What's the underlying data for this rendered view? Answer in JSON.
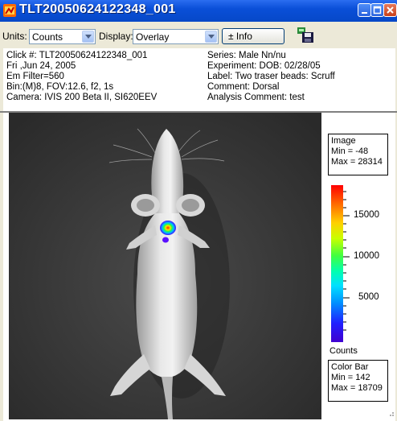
{
  "window": {
    "title": "TLT20050624122348_001"
  },
  "toolbar": {
    "units_label": "Units:",
    "units_value": "Counts",
    "display_label": "Display:",
    "display_value": "Overlay",
    "info_button": "± Info"
  },
  "info": {
    "left": [
      "Click #: TLT20050624122348_001",
      "Fri ,Jun 24, 2005",
      "Em Filter=560",
      "Bin:(M)8, FOV:12.6, f2, 1s",
      "Camera: IVIS 200 Beta II, SI620EEV"
    ],
    "right": [
      "Series: Male Nn/nu",
      "Experiment: DOB: 02/28/05",
      "Label: Two traser beads:  Scruff",
      "Comment: Dorsal",
      "Analysis Comment: test"
    ]
  },
  "image_legend": {
    "line1": "Image",
    "line2": "Min = -48",
    "line3": "Max = 28314"
  },
  "colorbar": {
    "ticks": [
      "15000",
      "10000",
      "5000"
    ],
    "units": "Counts",
    "legend_line1": "Color Bar",
    "legend_line2": "Min = 142",
    "legend_line3": "Max = 18709",
    "colors": [
      "#ff0000",
      "#ffd000",
      "#40ff40",
      "#00e0ff",
      "#2020ff",
      "#4000d0"
    ]
  }
}
